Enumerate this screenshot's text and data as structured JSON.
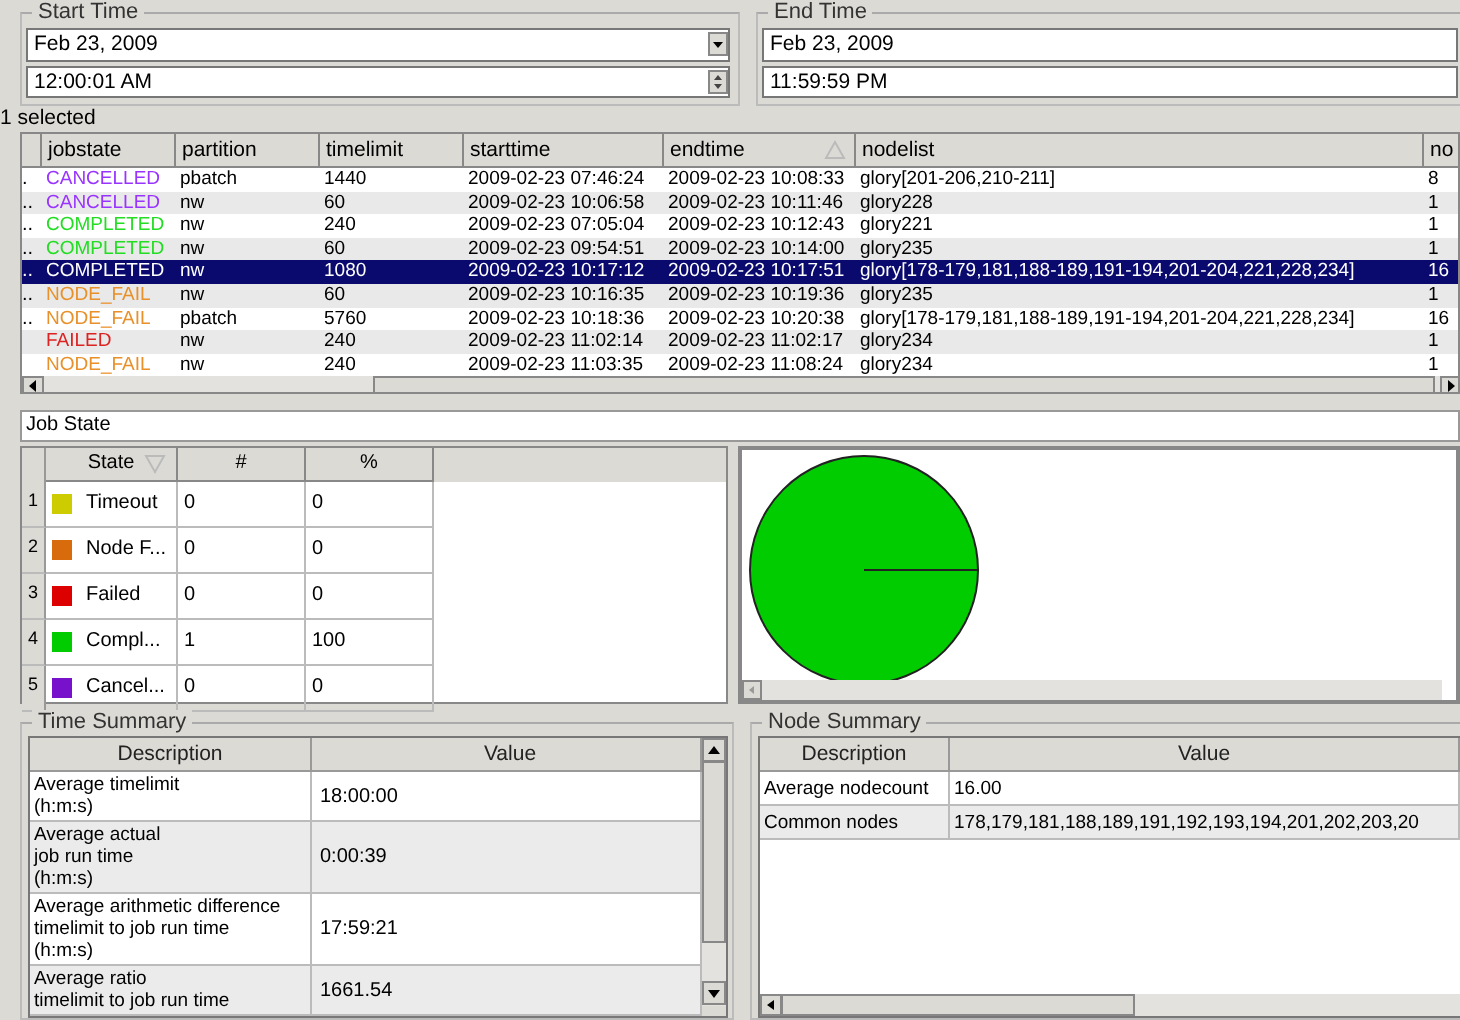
{
  "start_time": {
    "title": "Start Time",
    "date": "Feb 23, 2009",
    "time": "12:00:01 AM"
  },
  "end_time": {
    "title": "End Time",
    "date": "Feb 23, 2009",
    "time": "11:59:59 PM"
  },
  "selection_count": "1 selected",
  "jobs_table": {
    "columns": [
      {
        "label": "jobstate"
      },
      {
        "label": "partition"
      },
      {
        "label": "timelimit"
      },
      {
        "label": "starttime"
      },
      {
        "label": "endtime",
        "sorted_ascending": true
      },
      {
        "label": "nodelist"
      },
      {
        "label": "no"
      }
    ],
    "rows": [
      {
        "column_1": ".",
        "jobstate": "CANCELLED",
        "color": "#9933ff",
        "partition": "pbatch",
        "timelimit": "1440",
        "starttime": "2009-02-23 07:46:24",
        "endtime": "2009-02-23 10:08:33",
        "nodelist": "glory[201-206,210-211]",
        "no": "8",
        "selected": false
      },
      {
        "column_1": "..",
        "jobstate": "CANCELLED",
        "color": "#9933ff",
        "partition": "nw",
        "timelimit": "60",
        "starttime": "2009-02-23 10:06:58",
        "endtime": "2009-02-23 10:11:46",
        "nodelist": "glory228",
        "no": "1",
        "selected": false
      },
      {
        "column_1": "..",
        "jobstate": "COMPLETED",
        "color": "#22dd22",
        "partition": "nw",
        "timelimit": "240",
        "starttime": "2009-02-23 07:05:04",
        "endtime": "2009-02-23 10:12:43",
        "nodelist": "glory221",
        "no": "1",
        "selected": false
      },
      {
        "column_1": "..",
        "jobstate": "COMPLETED",
        "color": "#22dd22",
        "partition": "nw",
        "timelimit": "60",
        "starttime": "2009-02-23 09:54:51",
        "endtime": "2009-02-23 10:14:00",
        "nodelist": "glory235",
        "no": "1",
        "selected": false
      },
      {
        "column_1": "..",
        "jobstate": "COMPLETED",
        "partition": "nw",
        "timelimit": "1080",
        "starttime": "2009-02-23 10:17:12",
        "endtime": "2009-02-23 10:17:51",
        "nodelist": "glory[178-179,181,188-189,191-194,201-204,221,228,234]",
        "no": "16",
        "selected": true
      },
      {
        "column_1": "..",
        "jobstate": "NODE_FAIL",
        "color": "#e8902a",
        "partition": "nw",
        "timelimit": "60",
        "starttime": "2009-02-23 10:16:35",
        "endtime": "2009-02-23 10:19:36",
        "nodelist": "glory235",
        "no": "1",
        "selected": false
      },
      {
        "column_1": "..",
        "jobstate": "NODE_FAIL",
        "color": "#e8902a",
        "partition": "pbatch",
        "timelimit": "5760",
        "starttime": "2009-02-23 10:18:36",
        "endtime": "2009-02-23 10:20:38",
        "nodelist": "glory[178-179,181,188-189,191-194,201-204,221,228,234]",
        "no": "16",
        "selected": false
      },
      {
        "jobstate": "FAILED",
        "color": "#dd2222",
        "partition": "nw",
        "timelimit": "240",
        "starttime": "2009-02-23 11:02:14",
        "endtime": "2009-02-23 11:02:17",
        "nodelist": "glory234",
        "no": "1",
        "selected": false
      },
      {
        "jobstate": "NODE_FAIL",
        "color": "#e8902a",
        "partition": "nw",
        "timelimit": "240",
        "starttime": "2009-02-23 11:03:35",
        "endtime": "2009-02-23 11:08:24",
        "nodelist": "glory234",
        "no": "1",
        "selected": false
      }
    ]
  },
  "chart_selector": {
    "value": "Job State"
  },
  "state_table": {
    "columns": [
      {
        "label": "State",
        "sorted_ascending": false
      },
      {
        "label": "#"
      },
      {
        "label": "%"
      }
    ],
    "rows": [
      {
        "index": "1",
        "state": "Timeout",
        "color": "#cccc00",
        "count": "0",
        "percent": "0"
      },
      {
        "index": "2",
        "state": "Node F...",
        "color": "#d86c0c",
        "count": "0",
        "percent": "0"
      },
      {
        "index": "3",
        "state": "Failed",
        "color": "#dd0000",
        "count": "0",
        "percent": "0"
      },
      {
        "index": "4",
        "state": "Compl...",
        "color": "#00cc00",
        "count": "1",
        "percent": "100"
      },
      {
        "index": "5",
        "state": "Cancel...",
        "color": "#7711cc",
        "count": "0",
        "percent": "0"
      }
    ]
  },
  "pie": {
    "chart_data": {
      "type": "pie",
      "values": [
        0,
        0,
        0,
        1,
        0
      ]
    }
  },
  "time_summary": {
    "title": "Time Summary",
    "columns": [
      "Description",
      "Value"
    ],
    "rows": [
      {
        "description": "Average timelimit\n(h:m:s)",
        "value": "18:00:00"
      },
      {
        "description": "Average actual\njob run time\n(h:m:s)",
        "value": "0:00:39"
      },
      {
        "description": "Average arithmetic difference\ntimelimit to job run time\n(h:m:s)",
        "value": "17:59:21"
      },
      {
        "description": "Average ratio\ntimelimit to job run time",
        "value": "1661.54"
      }
    ]
  },
  "node_summary": {
    "title": "Node Summary",
    "columns": [
      "Description",
      "Value"
    ],
    "rows": [
      {
        "description": "Average nodecount",
        "value": "16.00"
      },
      {
        "description": "Common nodes",
        "value": "178,179,181,188,189,191,192,193,194,201,202,203,20"
      }
    ]
  }
}
